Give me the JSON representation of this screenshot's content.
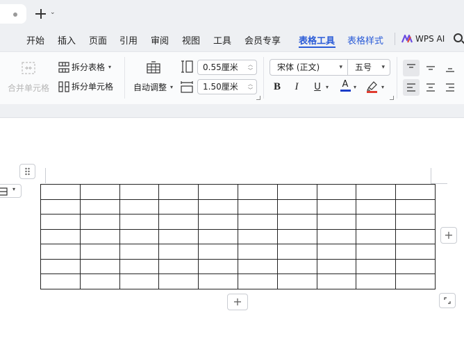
{
  "titlebar": {
    "new_tab_menu": "⌄"
  },
  "menu": {
    "items": [
      "开始",
      "插入",
      "页面",
      "引用",
      "审阅",
      "视图",
      "工具",
      "会员专享",
      "表格工具",
      "表格样式"
    ],
    "active": "表格工具",
    "wps_ai": "WPS AI"
  },
  "ribbon": {
    "merge_cells": "合并单元格",
    "split_table": "拆分表格",
    "split_cells": "拆分单元格",
    "auto_fit": "自动调整",
    "row_height": "0.55厘米",
    "col_width": "1.50厘米",
    "font_name": "宋体 (正文)",
    "font_size": "五号",
    "bold": "B",
    "italic": "I",
    "underline": "U",
    "font_color_glyph": "A",
    "font_color": "#1a3cc8",
    "highlight_color": "#e03b2f"
  },
  "table": {
    "rows": 7,
    "cols": 10
  },
  "colors": {
    "accent": "#2a5bd7"
  }
}
